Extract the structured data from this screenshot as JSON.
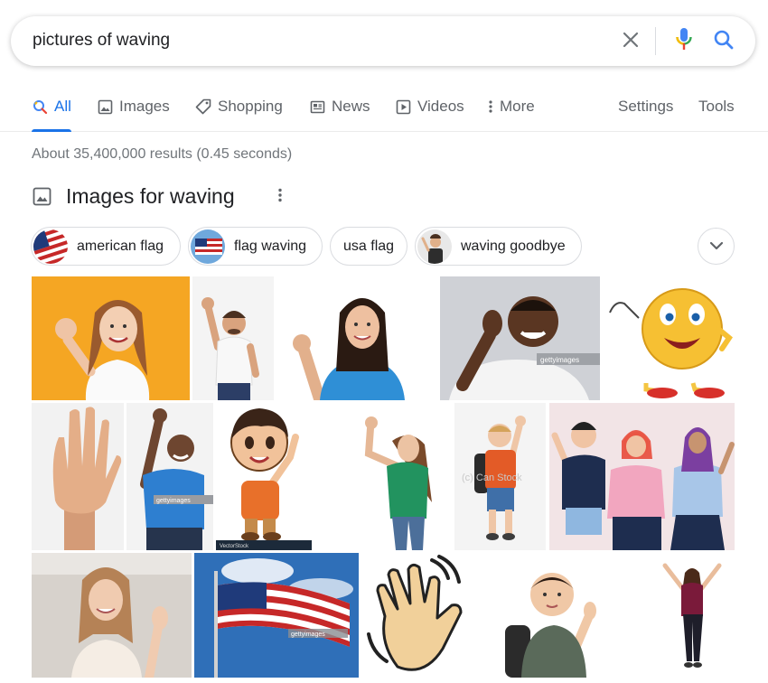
{
  "search": {
    "query": "pictures of waving",
    "icons": {
      "clear": "close-icon",
      "voice": "microphone-icon",
      "submit": "search-icon"
    }
  },
  "tabs": [
    {
      "label": "All",
      "icon": "search-icon",
      "active": true
    },
    {
      "label": "Images",
      "icon": "image-icon"
    },
    {
      "label": "Shopping",
      "icon": "tag-icon"
    },
    {
      "label": "News",
      "icon": "news-icon"
    },
    {
      "label": "Videos",
      "icon": "play-icon"
    },
    {
      "label": "More",
      "icon": "dots-vertical-icon"
    }
  ],
  "tools": {
    "settings": "Settings",
    "tools": "Tools"
  },
  "result_stats": "About 35,400,000 results (0.45 seconds)",
  "images_section": {
    "title": "Images for waving",
    "chips": [
      {
        "label": "american flag",
        "thumb": "us-flag"
      },
      {
        "label": "flag waving",
        "thumb": "us-flag"
      },
      {
        "label": "usa flag"
      },
      {
        "label": "waving goodbye",
        "thumb": "child-waving"
      }
    ]
  },
  "image_grid": {
    "watermarks": {
      "getty": "gettyimages",
      "canstock": "(c) Can Stock",
      "vector": "VectorStock"
    }
  },
  "colors": {
    "accent": "#1a73e8",
    "text_secondary": "#5f6368",
    "stats": "#70757a",
    "border": "#dadce0"
  }
}
